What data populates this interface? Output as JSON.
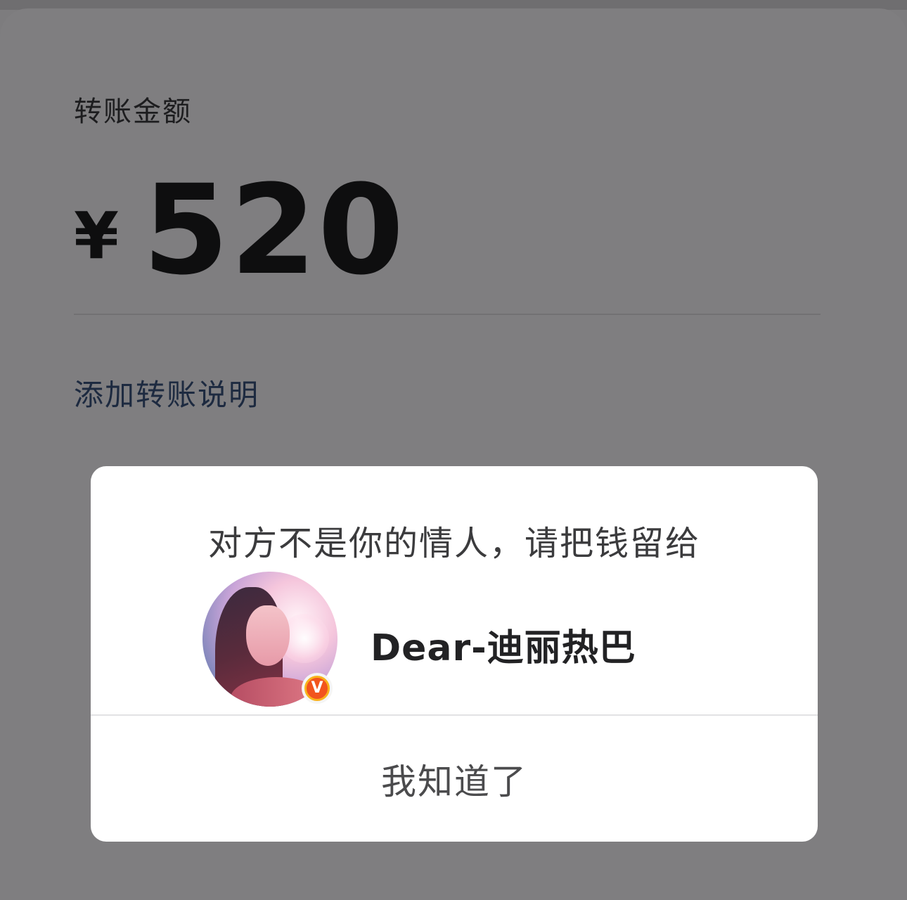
{
  "transfer": {
    "amount_label": "转账金额",
    "currency_symbol": "¥",
    "amount": "520",
    "add_note_label": "添加转账说明"
  },
  "dialog": {
    "message": "对方不是你的情人，请把钱留给",
    "recipient_name": "Dear-迪丽热巴",
    "verified_badge": "V",
    "confirm_label": "我知道了"
  },
  "colors": {
    "overlay": "#7f7e80",
    "dialog_bg": "#ffffff",
    "badge_orange": "#f2541d",
    "badge_ring": "#f9b21c"
  },
  "icons": {
    "verified": "verified-v-badge-icon"
  }
}
